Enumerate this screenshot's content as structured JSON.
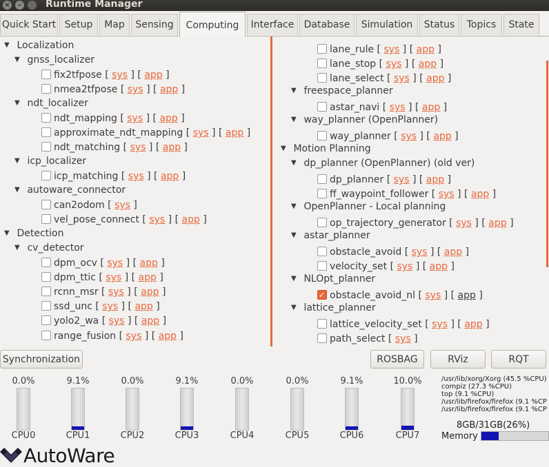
{
  "window": {
    "title": "Runtime Manager"
  },
  "tabs": [
    "Quick Start",
    "Setup",
    "Map",
    "Sensing",
    "Computing",
    "Interface",
    "Database",
    "Simulation",
    "Status",
    "Topics",
    "State"
  ],
  "active_tab": "Computing",
  "link_sys": "sys",
  "link_app": "app",
  "bracket_open": "[",
  "bracket_close": "]",
  "left_tree": [
    {
      "label": "Localization"
    },
    {
      "label": "gnss_localizer"
    },
    {
      "label": "fix2tfpose"
    },
    {
      "label": "nmea2tfpose"
    },
    {
      "label": "ndt_localizer"
    },
    {
      "label": "ndt_mapping"
    },
    {
      "label": "approximate_ndt_mapping"
    },
    {
      "label": "ndt_matching"
    },
    {
      "label": "icp_localizer"
    },
    {
      "label": "icp_matching"
    },
    {
      "label": "autoware_connector"
    },
    {
      "label": "can2odom"
    },
    {
      "label": "vel_pose_connect"
    },
    {
      "label": "Detection"
    },
    {
      "label": "cv_detector"
    },
    {
      "label": "dpm_ocv"
    },
    {
      "label": "dpm_ttic"
    },
    {
      "label": "rcnn_msr"
    },
    {
      "label": "ssd_unc"
    },
    {
      "label": "yolo2_wa"
    },
    {
      "label": "range_fusion"
    }
  ],
  "right_tree": [
    {
      "label": "lane_rule"
    },
    {
      "label": "lane_stop"
    },
    {
      "label": "lane_select"
    },
    {
      "label": "freespace_planner"
    },
    {
      "label": "astar_navi"
    },
    {
      "label": "way_planner (OpenPlanner)"
    },
    {
      "label": "way_planner"
    },
    {
      "label": "Motion Planning"
    },
    {
      "label": "dp_planner (OpenPlanner) (old ver)"
    },
    {
      "label": "dp_planner"
    },
    {
      "label": "ff_waypoint_follower"
    },
    {
      "label": "OpenPlanner - Local planning"
    },
    {
      "label": "op_trajectory_generator"
    },
    {
      "label": "astar_planner"
    },
    {
      "label": "obstacle_avoid"
    },
    {
      "label": "velocity_set"
    },
    {
      "label": "NLOpt_planner"
    },
    {
      "label": "obstacle_avoid_nl"
    },
    {
      "label": "lattice_planner"
    },
    {
      "label": "lattice_velocity_set"
    },
    {
      "label": "path_select"
    }
  ],
  "buttons": {
    "synchronization": "Synchronization",
    "rosbag": "ROSBAG",
    "rviz": "RViz",
    "rqt": "RQT"
  },
  "cpus": [
    {
      "label": "CPU0",
      "pct": "0.0%",
      "value": 0.0
    },
    {
      "label": "CPU1",
      "pct": "9.1%",
      "value": 9.1
    },
    {
      "label": "CPU2",
      "pct": "0.0%",
      "value": 0.0
    },
    {
      "label": "CPU3",
      "pct": "9.1%",
      "value": 9.1
    },
    {
      "label": "CPU4",
      "pct": "0.0%",
      "value": 0.0
    },
    {
      "label": "CPU5",
      "pct": "0.0%",
      "value": 0.0
    },
    {
      "label": "CPU6",
      "pct": "9.1%",
      "value": 9.1
    },
    {
      "label": "CPU7",
      "pct": "10.0%",
      "value": 10.0
    }
  ],
  "processes": [
    "/usr/lib/xorg/Xorg (45.5 %CPU)",
    "compiz (27.3 %CPU)",
    "top (9.1 %CPU)",
    "/usr/lib/firefox/firefox (9.1 %CP",
    "/usr/lib/firefox/firefox (9.1 %CP"
  ],
  "memory": {
    "text": "8GB/31GB(26%)",
    "label": "Memory",
    "value": 26
  },
  "logo": {
    "text": "AutoWare"
  },
  "colors": {
    "accent": "#e8683a",
    "bar": "#1414b4"
  }
}
